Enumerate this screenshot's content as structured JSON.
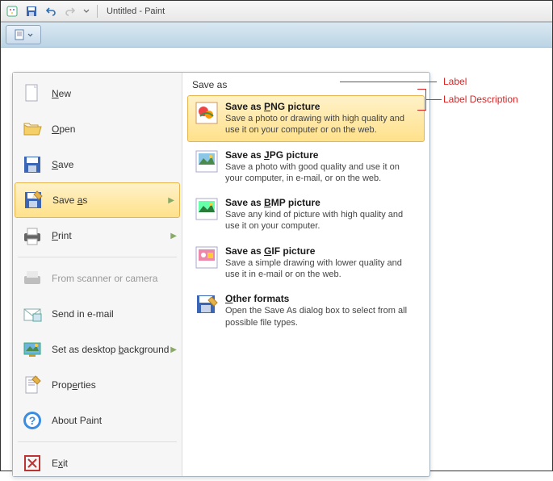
{
  "title": "Untitled - Paint",
  "ribbon": {
    "file_button": ""
  },
  "menu": [
    {
      "icon": "new-icon",
      "label": "New",
      "u": "N",
      "rest": "ew"
    },
    {
      "icon": "open-icon",
      "label": "Open",
      "u": "O",
      "rest": "pen"
    },
    {
      "icon": "save-icon",
      "label": "Save",
      "u": "S",
      "rest": "ave"
    },
    {
      "icon": "save-as-icon",
      "label": "Save as",
      "u": "a",
      "pre": "Save ",
      "rest": "s",
      "selected": true,
      "arrow": true
    },
    {
      "icon": "print-icon",
      "label": "Print",
      "u": "P",
      "rest": "rint",
      "arrow": true
    },
    {
      "icon": "scanner-icon",
      "label": "From scanner or camera",
      "plain": true,
      "disabled": true
    },
    {
      "icon": "email-icon",
      "label": "Send in e-mail",
      "plain": true
    },
    {
      "icon": "desktop-icon",
      "label": "Set as desktop background",
      "u": "b",
      "pre": "Set as desktop ",
      "rest": "ackground",
      "arrow": true
    },
    {
      "icon": "properties-icon",
      "label": "Properties",
      "u": "e",
      "pre": "Prop",
      "rest": "rties"
    },
    {
      "icon": "about-icon",
      "label": "About Paint",
      "plain": true
    },
    {
      "icon": "exit-icon",
      "label": "Exit",
      "u": "x",
      "pre": "E",
      "rest": "it"
    }
  ],
  "submenu": {
    "title": "Save as",
    "items": [
      {
        "icon": "png-icon",
        "label": "Save as PNG picture",
        "u": "P",
        "pre": "Save as ",
        "rest": "NG picture",
        "desc": "Save a photo or drawing with high quality and use it on your computer or on the web.",
        "hl": true
      },
      {
        "icon": "jpg-icon",
        "label": "Save as JPG picture",
        "u": "J",
        "pre": "Save as ",
        "rest": "PG picture",
        "desc": "Save a photo with good quality and use it on your computer, in e-mail, or on the web."
      },
      {
        "icon": "bmp-icon",
        "label": "Save as BMP picture",
        "u": "B",
        "pre": "Save as ",
        "rest": "MP picture",
        "desc": "Save any kind of picture with high quality and use it on your computer."
      },
      {
        "icon": "gif-icon",
        "label": "Save as GIF picture",
        "u": "G",
        "pre": "Save as ",
        "rest": "IF picture",
        "desc": "Save a simple drawing with lower quality and use it in e-mail or on the web."
      },
      {
        "icon": "other-icon",
        "label": "Other formats",
        "u": "O",
        "rest": "ther formats",
        "desc": "Open the Save As dialog box to select from all possible file types."
      }
    ]
  },
  "annotations": {
    "label": "Label",
    "label_desc": "Label Description"
  }
}
